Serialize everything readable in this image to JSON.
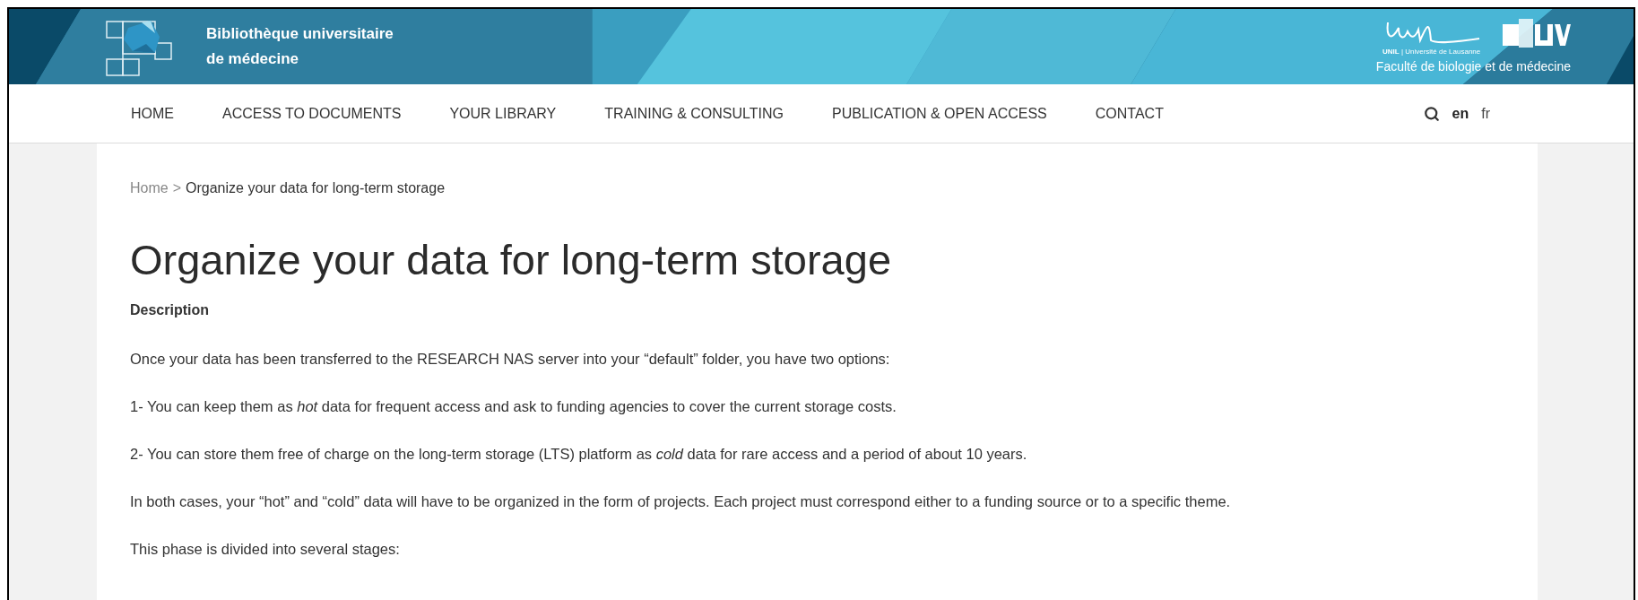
{
  "header": {
    "title_lines": [
      "Bibliothèque universitaire",
      "de médecine"
    ],
    "partner_caption": "**UNIL** | Université de Lausanne",
    "faculty": "Faculté de biologie et de médecine"
  },
  "nav": {
    "items": [
      {
        "label": "HOME"
      },
      {
        "label": "ACCESS TO DOCUMENTS"
      },
      {
        "label": "YOUR LIBRARY"
      },
      {
        "label": "TRAINING & CONSULTING"
      },
      {
        "label": "PUBLICATION & OPEN ACCESS"
      },
      {
        "label": "CONTACT"
      }
    ],
    "languages": [
      {
        "label": "en",
        "selected": true
      },
      {
        "label": "fr",
        "selected": false
      }
    ]
  },
  "breadcrumb": {
    "items": [
      "Home",
      "Organize your data for long-term storage"
    ],
    "separator": ">"
  },
  "title": "Organize your data for long-term storage",
  "section_label": "Description",
  "paragraphs": [
    "Once your data has been transferred to the RESEARCH NAS server into your “default” folder, you have two options:",
    "1- You can keep them as *hot* data for frequent access and ask to funding agencies to cover the current storage costs.",
    "2- You can store them free of charge on the long-term storage (LTS) platform as *cold* data for rare access and a period of about 10 years.",
    "In both cases, your “hot” and “cold” data will have to be organized in the form of projects. Each project must correspond either to a funding source or to a specific theme.",
    "This phase is divided into several stages:"
  ]
}
